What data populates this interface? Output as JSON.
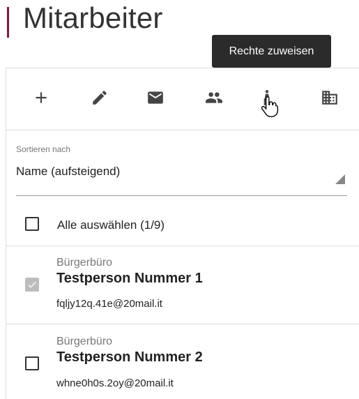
{
  "header": {
    "title": "Mitarbeiter"
  },
  "tooltip": {
    "text": "Rechte zuweisen"
  },
  "toolbar": {
    "icons": [
      "plus-icon",
      "pencil-icon",
      "mail-icon",
      "group-icon",
      "person-accessibility-icon",
      "building-icon"
    ]
  },
  "sort": {
    "label": "Sortieren nach",
    "value": "Name (aufsteigend)"
  },
  "select_all": {
    "label": "Alle auswählen (1/9)"
  },
  "employees": [
    {
      "org": "Bürgerbüro",
      "name": "Testperson Nummer 1",
      "email": "fqljy12q.41e@20mail.it",
      "checked": true
    },
    {
      "org": "Bürgerbüro",
      "name": "Testperson Nummer 2",
      "email": "whne0h0s.2oy@20mail.it",
      "checked": false
    }
  ],
  "colors": {
    "accent": "#8a1538",
    "tooltip_bg": "#2b2b2b",
    "checked_box": "#bdbdbd"
  }
}
